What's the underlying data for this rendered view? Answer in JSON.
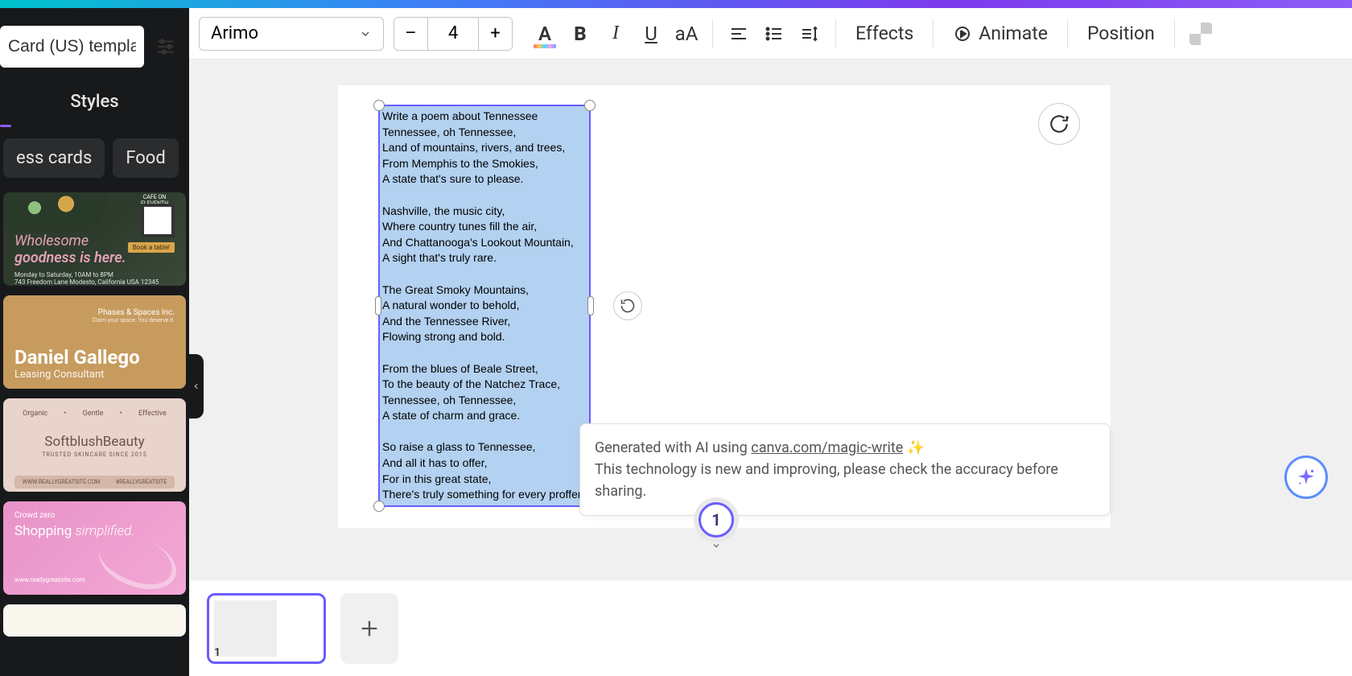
{
  "sidebar": {
    "search_value": "Card (US) templat",
    "styles_tab": "Styles",
    "chips": [
      "ess cards",
      "Food"
    ],
    "templates": {
      "t1": {
        "cafe": "CAFE ON ELEVENTH",
        "title": "Wholesome",
        "sub": "goodness is here.",
        "meta": "Monday to Saturday, 10AM to 8PM\n743 Freedom Lane Modesto, California USA 12345",
        "badge": "Book a table!"
      },
      "t2": {
        "logo": "Phases & Spaces Inc.",
        "logo_sub": "Claim your space. You deserve it.",
        "name": "Daniel Gallego",
        "role": "Leasing Consultant"
      },
      "t3": {
        "tag1": "Organic",
        "tag2": "Gentle",
        "tag3": "Effective",
        "brand": "SoftblushBeauty",
        "since": "TRUSTED SKINCARE SINCE 2015",
        "url1": "WWW.REALLYGREATSITE.COM",
        "url2": "#REALLYGREATSITE"
      },
      "t4": {
        "crowd": "Crowd zero",
        "shop_a": "Shopping ",
        "shop_b": "simplified.",
        "url": "www.reallygreatsite.com"
      }
    }
  },
  "toolbar": {
    "font": "Arimo",
    "size": "4",
    "minus": "–",
    "plus": "+",
    "text_color": "A",
    "bold": "B",
    "italic": "I",
    "underline": "U",
    "case": "aA",
    "effects": "Effects",
    "animate": "Animate",
    "position": "Position"
  },
  "canvas": {
    "text": "Write a poem about Tennessee\nTennessee, oh Tennessee,\nLand of mountains, rivers, and trees,\nFrom Memphis to the Smokies,\nA state that's sure to please.\n\nNashville, the music city,\nWhere country tunes fill the air,\nAnd Chattanooga's Lookout Mountain,\nA sight that's truly rare.\n\nThe Great Smoky Mountains,\nA natural wonder to behold,\nAnd the Tennessee River,\nFlowing strong and bold.\n\nFrom the blues of Beale Street,\nTo the beauty of the Natchez Trace,\nTennessee, oh Tennessee,\nA state of charm and grace.\n\nSo raise a glass to Tennessee,\nAnd all it has to offer,\nFor in this great state,\nThere's truly something for every proffer",
    "page_number": "1"
  },
  "tooltip": {
    "line1_a": "Generated with AI using ",
    "line1_link": "canva.com/magic-write",
    "line1_b": " ✨",
    "line2": "This technology is new and improving, please check the accuracy before sharing."
  },
  "thumbs": {
    "num": "1"
  }
}
